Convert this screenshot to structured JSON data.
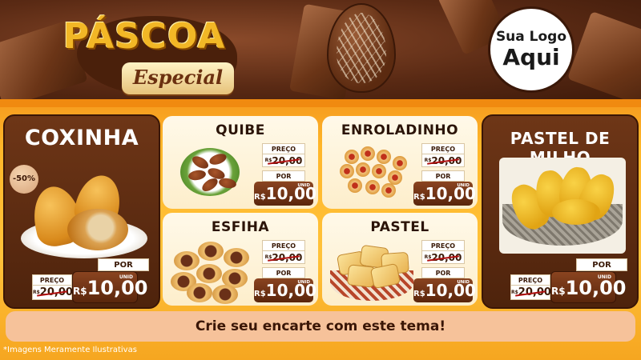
{
  "header": {
    "title": "PÁSCOA",
    "subtitle": "Especial",
    "logo_line1": "Sua Logo",
    "logo_line2": "Aqui"
  },
  "products": {
    "coxinha": {
      "name": "COXINHA",
      "discount": "-50%",
      "por_label": "POR",
      "preco_label": "PREÇO",
      "old_currency": "R$",
      "old_price": "20,00",
      "currency": "R$",
      "price": "10,00",
      "unit": "UNID"
    },
    "quibe": {
      "name": "QUIBE",
      "preco_label": "PREÇO",
      "old_currency": "R$",
      "old_price": "20,00",
      "por_label": "POR",
      "currency": "R$",
      "price": "10,00",
      "unit": "UNID"
    },
    "enroladinho": {
      "name": "ENROLADINHO",
      "preco_label": "PREÇO",
      "old_currency": "R$",
      "old_price": "20,00",
      "por_label": "POR",
      "currency": "R$",
      "price": "10,00",
      "unit": "UNID"
    },
    "esfiha": {
      "name": "ESFIHA",
      "preco_label": "PREÇO",
      "old_currency": "R$",
      "old_price": "20,00",
      "por_label": "POR",
      "currency": "R$",
      "price": "10,00",
      "unit": "UNID"
    },
    "pastel": {
      "name": "PASTEL",
      "preco_label": "PREÇO",
      "old_currency": "R$",
      "old_price": "20,00",
      "por_label": "POR",
      "currency": "R$",
      "price": "10,00",
      "unit": "UNID"
    },
    "pastel_de_milho": {
      "name": "PASTEL DE MILHO",
      "por_label": "POR",
      "preco_label": "PREÇO",
      "old_currency": "R$",
      "old_price": "20,00",
      "currency": "R$",
      "price": "10,00",
      "unit": "UNID"
    }
  },
  "cta": "Crie seu encarte com este tema!",
  "footnote": "*Imagens Meramente Ilustrativas",
  "colors": {
    "chocolate": "#5a2a12",
    "orange": "#ffb629",
    "cream": "#fff9e9",
    "cta_bg": "#f6c29a"
  }
}
